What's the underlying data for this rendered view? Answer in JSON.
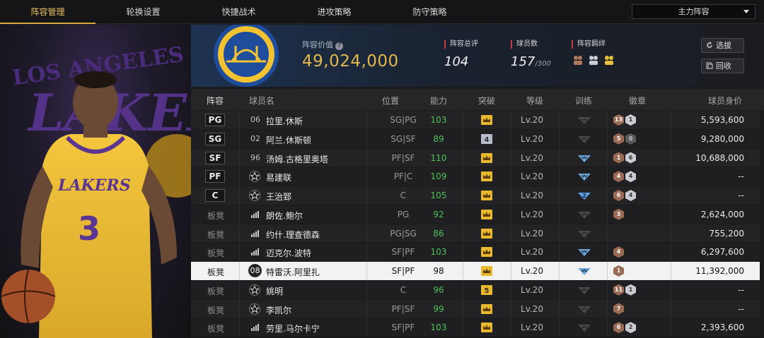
{
  "nav": {
    "tabs": [
      "阵容管理",
      "轮换设置",
      "快捷战术",
      "进攻策略",
      "防守策略"
    ],
    "active_index": 0,
    "lineup_select": "主力阵容"
  },
  "team": {
    "value_label": "阵容价值",
    "value": "49,024,000",
    "rating_label": "阵容总评",
    "rating": "104",
    "players_label": "球员数",
    "players": "157",
    "players_max": "/300",
    "bond_label": "阵容羁绊"
  },
  "buttons": {
    "select": "选拔",
    "recycle": "回收"
  },
  "table": {
    "headers": [
      "阵容",
      "球员名",
      "位置",
      "能力",
      "突破",
      "等级",
      "训练",
      "徽章",
      "球员身价"
    ],
    "rows": [
      {
        "slot": "PG",
        "num": "06",
        "name": "拉里.休斯",
        "pos": "SG|PG",
        "ability": "103",
        "breakthrough": "crown",
        "level": "Lv.20",
        "train": "none",
        "badges": [
          [
            "br",
            "13"
          ],
          [
            "sv",
            "1"
          ]
        ],
        "value": "5,593,600"
      },
      {
        "slot": "SG",
        "num": "02",
        "name": "阿兰.休斯顿",
        "pos": "SG|SF",
        "ability": "89",
        "breakthrough": "4",
        "level": "Lv.20",
        "train": "none",
        "badges": [
          [
            "br",
            "5"
          ],
          [
            "dk",
            "0"
          ]
        ],
        "value": "9,280,000"
      },
      {
        "slot": "SF",
        "num": "96",
        "name": "汤姆.古格里奥塔",
        "pos": "PF|SF",
        "ability": "110",
        "breakthrough": "crown",
        "level": "Lv.20",
        "train": "blue",
        "badges": [
          [
            "br",
            "1"
          ],
          [
            "sv",
            "6"
          ]
        ],
        "value": "10,688,000"
      },
      {
        "slot": "PF",
        "num": "star",
        "name": "易建联",
        "pos": "PF|C",
        "ability": "109",
        "breakthrough": "crown",
        "level": "Lv.20",
        "train": "blue",
        "badges": [
          [
            "br",
            "4"
          ],
          [
            "sv",
            "4"
          ]
        ],
        "value": "--"
      },
      {
        "slot": "C",
        "num": "star",
        "name": "王治郅",
        "pos": "C",
        "ability": "105",
        "breakthrough": "crown",
        "level": "Lv.20",
        "train": "blue2",
        "badges": [
          [
            "br",
            "6"
          ],
          [
            "sv",
            "4"
          ]
        ],
        "value": "--"
      },
      {
        "slot": "板凳",
        "num": "bars",
        "name": "朗佐.鲍尔",
        "pos": "PG",
        "ability": "92",
        "breakthrough": "crown",
        "level": "Lv.20",
        "train": "none",
        "badges": [
          [
            "br",
            "3"
          ]
        ],
        "value": "2,624,000"
      },
      {
        "slot": "板凳",
        "num": "bars",
        "name": "约什.理查德森",
        "pos": "PG|SG",
        "ability": "86",
        "breakthrough": "crown",
        "level": "Lv.20",
        "train": "none",
        "badges": [],
        "value": "755,200"
      },
      {
        "slot": "板凳",
        "num": "bars",
        "name": "迈克尔.波特",
        "pos": "SF|PF",
        "ability": "103",
        "breakthrough": "crown",
        "level": "Lv.20",
        "train": "blue",
        "badges": [
          [
            "br",
            "4"
          ]
        ],
        "value": "6,297,600"
      },
      {
        "slot": "板凳",
        "num": "08",
        "name": "特雷沃.阿里扎",
        "pos": "SF|PF",
        "ability": "98",
        "breakthrough": "crown",
        "level": "Lv.20",
        "train": "blue",
        "badges": [
          [
            "br",
            "1"
          ]
        ],
        "value": "11,392,000",
        "selected": true
      },
      {
        "slot": "板凳",
        "num": "star",
        "name": "姚明",
        "pos": "C",
        "ability": "96",
        "breakthrough": "5",
        "level": "Lv.20",
        "train": "none",
        "badges": [
          [
            "br",
            "11"
          ],
          [
            "sv",
            "1"
          ]
        ],
        "value": "--"
      },
      {
        "slot": "板凳",
        "num": "star",
        "name": "李凯尔",
        "pos": "PF|SF",
        "ability": "99",
        "breakthrough": "crown",
        "level": "Lv.20",
        "train": "none",
        "badges": [
          [
            "br",
            "7"
          ]
        ],
        "value": "--"
      },
      {
        "slot": "板凳",
        "num": "bars",
        "name": "劳里.马尔卡宁",
        "pos": "SF|PF",
        "ability": "103",
        "breakthrough": "crown",
        "level": "Lv.20",
        "train": "none",
        "badges": [
          [
            "br",
            "6"
          ],
          [
            "sv",
            "2"
          ]
        ],
        "value": "2,393,600"
      }
    ]
  },
  "art": {
    "jersey_number": "3",
    "jersey_team": "LAKERS",
    "bg_text": "LAKERS",
    "bg_top": "LOS ANGELES"
  },
  "colors": {
    "accent_gold": "#d9a93a",
    "ability_green": "#4fc25a",
    "stat_red": "#c93a3a"
  }
}
